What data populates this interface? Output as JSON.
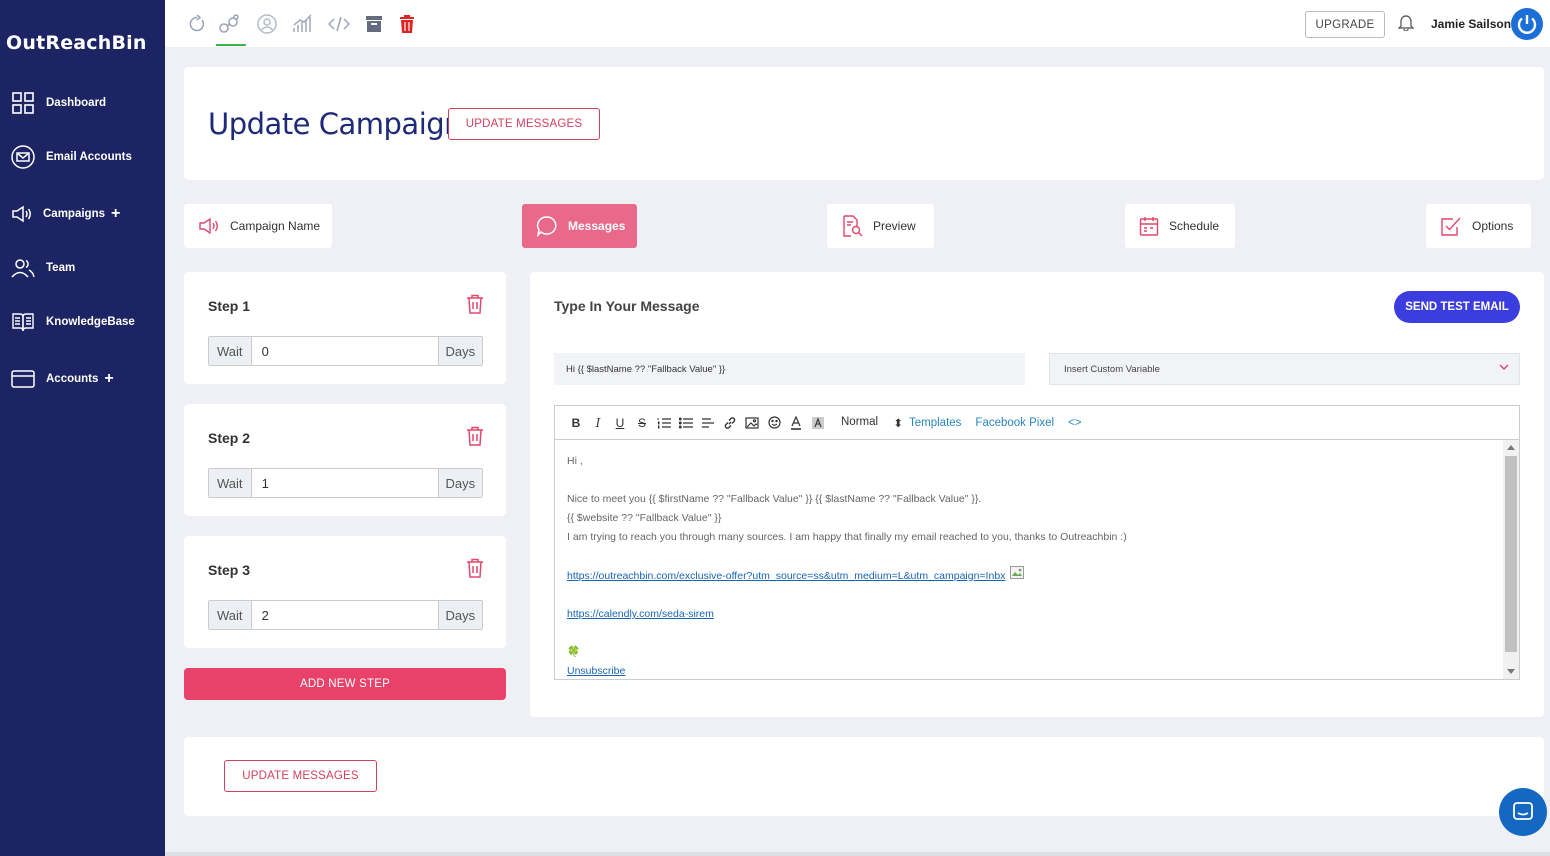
{
  "app": {
    "logo": "OutReachBin"
  },
  "sidebar": {
    "items": [
      {
        "label": "Dashboard",
        "icon": "dashboard-grid-icon",
        "has_plus": false
      },
      {
        "label": "Email Accounts",
        "icon": "email-icon",
        "has_plus": false
      },
      {
        "label": "Campaigns",
        "icon": "megaphone-icon",
        "has_plus": true
      },
      {
        "label": "Team",
        "icon": "team-icon",
        "has_plus": false
      },
      {
        "label": "KnowledgeBase",
        "icon": "book-icon",
        "has_plus": false
      },
      {
        "label": "Accounts",
        "icon": "card-icon",
        "has_plus": true
      }
    ],
    "plus_symbol": "+"
  },
  "topbar": {
    "tools": [
      "refresh-icon",
      "workflow-icon",
      "user-circle-icon",
      "analytics-icon",
      "code-icon",
      "archive-icon",
      "delete-icon"
    ],
    "upgrade_label": "UPGRADE",
    "user_name": "Jamie Sailson"
  },
  "header": {
    "title": "Update Campaign",
    "update_button": "UPDATE MESSAGES"
  },
  "tabs": [
    {
      "label": "Campaign Name",
      "icon": "megaphone-icon",
      "active": false
    },
    {
      "label": "Messages",
      "icon": "chat-icon",
      "active": true
    },
    {
      "label": "Preview",
      "icon": "preview-doc-icon",
      "active": false
    },
    {
      "label": "Schedule",
      "icon": "calendar-icon",
      "active": false
    },
    {
      "label": "Options",
      "icon": "checkbox-icon",
      "active": false
    }
  ],
  "steps": [
    {
      "title": "Step 1",
      "wait_label": "Wait",
      "value": "0",
      "unit": "Days"
    },
    {
      "title": "Step 2",
      "wait_label": "Wait",
      "value": "1",
      "unit": "Days"
    },
    {
      "title": "Step 3",
      "wait_label": "Wait",
      "value": "2",
      "unit": "Days"
    }
  ],
  "add_step_label": "ADD NEW STEP",
  "message": {
    "title": "Type In Your Message",
    "send_test_label": "SEND TEST EMAIL",
    "subject_value": "Hi {{ $lastName ?? \"Fallback Value\" }}",
    "custom_variable_placeholder": "Insert Custom Variable",
    "toolbar": {
      "format_select": "Normal",
      "format_arrow": "⬍",
      "templates_link": "Templates",
      "facebook_pixel_link": "Facebook Pixel",
      "code_link": "<>"
    },
    "body": {
      "greeting": "Hi ,",
      "line1": "Nice to meet you {{ $firstName ?? \"Fallback Value\" }} {{ $lastName ?? \"Fallback Value\" }}.",
      "line2": "{{ $website ?? \"Fallback Value\" }}",
      "line3": "I am trying to reach you through many sources. I am happy that finally my email reached to you, thanks to Outreachbin :)",
      "link1": "https://outreachbin.com/exclusive-offer?utm_source=ss&utm_medium=L&utm_campaign=Inbx",
      "link2": "https://calendly.com/seda-sirem",
      "emoji": "🍀",
      "unsubscribe": "Unsubscribe"
    }
  },
  "footer": {
    "update_button": "UPDATE MESSAGES"
  },
  "colors": {
    "sidebar_bg": "#1c2463",
    "accent_pink": "#e8416a",
    "active_tab": "#e9698a",
    "send_button": "#3b3dde",
    "title_navy": "#1e2a78",
    "delete_red": "#e02424"
  }
}
